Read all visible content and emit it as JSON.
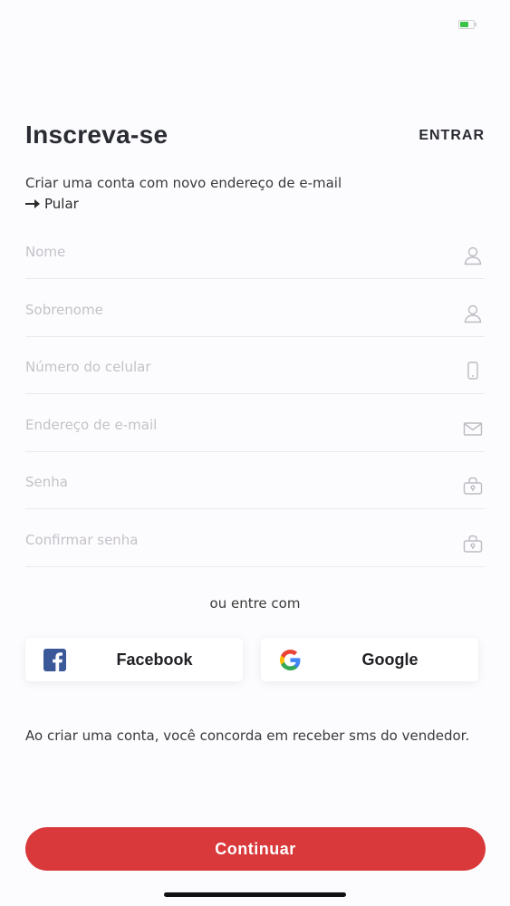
{
  "status_bar": {
    "battery_icon": "battery-icon",
    "battery_color": "#3cc34a"
  },
  "header": {
    "title": "Inscreva-se",
    "login_label": "ENTRAR"
  },
  "subtitle": "Criar uma conta com novo endereço de e-mail",
  "skip": {
    "label": "Pular",
    "icon": "arrow-right-icon"
  },
  "form": {
    "fields": [
      {
        "placeholder": "Nome",
        "value": "",
        "icon": "user-icon"
      },
      {
        "placeholder": "Sobrenome",
        "value": "",
        "icon": "user-icon"
      },
      {
        "placeholder": "Número do celular",
        "value": "",
        "icon": "phone-icon"
      },
      {
        "placeholder": "Endereço de e-mail",
        "value": "",
        "icon": "mail-icon"
      },
      {
        "placeholder": "Senha",
        "value": "",
        "icon": "lock-icon"
      },
      {
        "placeholder": "Confirmar senha",
        "value": "",
        "icon": "lock-icon"
      }
    ]
  },
  "social": {
    "divider_text": "ou entre com",
    "facebook_label": "Facebook",
    "facebook_icon": "facebook-icon",
    "facebook_color": "#3b5998",
    "google_label": "Google",
    "google_icon": "google-icon"
  },
  "terms_text": "Ao criar uma conta, você concorda em receber sms do vendedor.",
  "continue_label": "Continuar",
  "colors": {
    "accent": "#d9393b",
    "background": "#fcfbfd",
    "placeholder": "#c4c2c8",
    "divider": "#ebe9ee"
  }
}
